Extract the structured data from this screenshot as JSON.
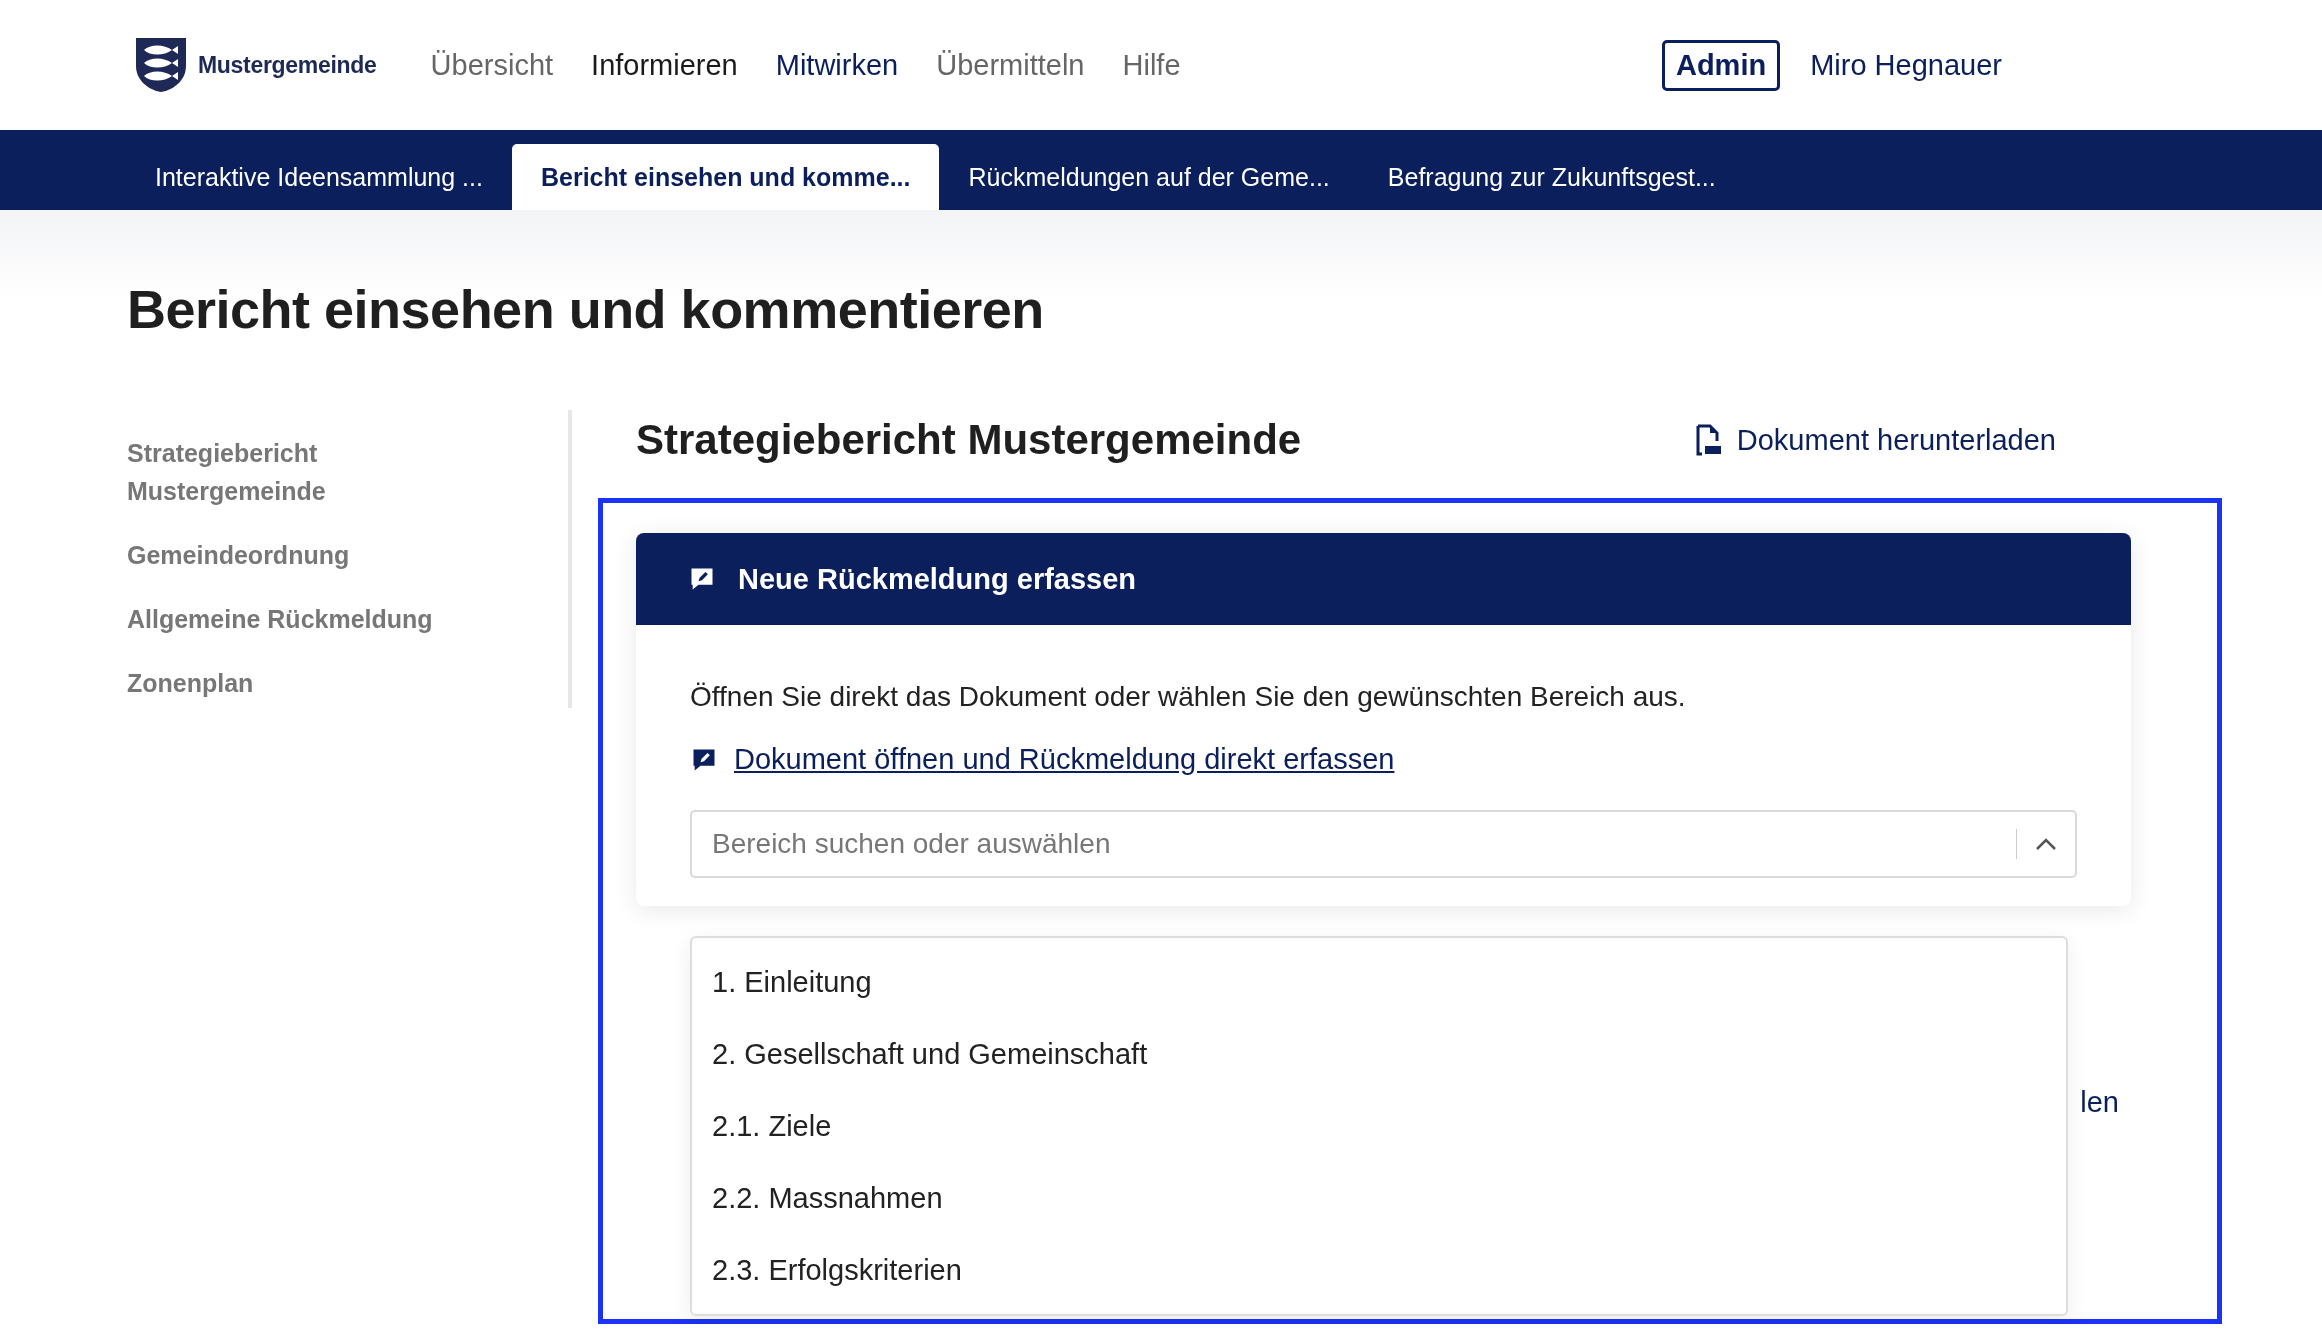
{
  "header": {
    "logo_text": "Mustergemeinde",
    "nav": [
      {
        "label": "Übersicht",
        "selected": false,
        "muted": true
      },
      {
        "label": "Informieren",
        "selected": false,
        "muted": false
      },
      {
        "label": "Mitwirken",
        "selected": true,
        "muted": false
      },
      {
        "label": "Übermitteln",
        "selected": false,
        "muted": true
      },
      {
        "label": "Hilfe",
        "selected": false,
        "muted": true
      }
    ],
    "admin_button": "Admin",
    "user_name": "Miro Hegnauer"
  },
  "tabs": [
    {
      "label": "Interaktive Ideensammlung ...",
      "selected": false
    },
    {
      "label": "Bericht einsehen und komme...",
      "selected": true
    },
    {
      "label": "Rückmeldungen auf der Geme...",
      "selected": false
    },
    {
      "label": "Befragung zur Zukunftsgest...",
      "selected": false
    }
  ],
  "page_title": "Bericht einsehen und kommentieren",
  "sidebar": {
    "items": [
      "Strategiebericht Mustergemeinde",
      "Gemeindeordnung",
      "Allgemeine Rückmeldung",
      "Zonenplan"
    ]
  },
  "document": {
    "title": "Strategiebericht Mustergemeinde",
    "download_link": "Dokument herunterladen"
  },
  "feedback_card": {
    "title": "Neue Rückmeldung erfassen",
    "intro": "Öffnen Sie direkt das Dokument oder wählen Sie den gewünschten Bereich aus.",
    "open_link": "Dokument öffnen und Rückmeldung direkt erfassen",
    "select": {
      "placeholder": "Bereich suchen oder auswählen",
      "expanded": true,
      "options": [
        "1. Einleitung",
        "2. Gesellschaft und Gemeinschaft",
        "2.1. Ziele",
        "2.2. Massnahmen",
        "2.3. Erfolgskriterien"
      ]
    }
  },
  "covered_link": "len"
}
